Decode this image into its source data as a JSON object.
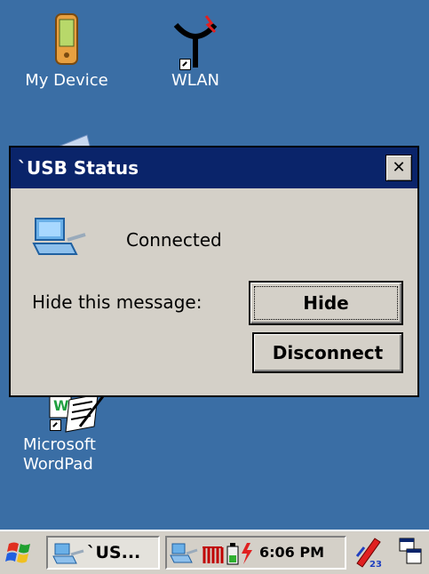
{
  "desktop": {
    "icons": [
      {
        "label": "My Device"
      },
      {
        "label": "WLAN"
      },
      {
        "label": "Microsoft"
      },
      {
        "label": "WordPad"
      }
    ]
  },
  "dialog": {
    "title": "`USB Status",
    "status_text": "Connected",
    "hide_prompt": "Hide this message:",
    "hide_button": "Hide",
    "disconnect_button": "Disconnect",
    "close_glyph": "✕"
  },
  "taskbar": {
    "task_label": "`US...",
    "clock": "6:06 PM"
  },
  "colors": {
    "desktop": "#3a6ea5",
    "titlebar": "#0a246a",
    "chrome": "#d4d0c8"
  }
}
